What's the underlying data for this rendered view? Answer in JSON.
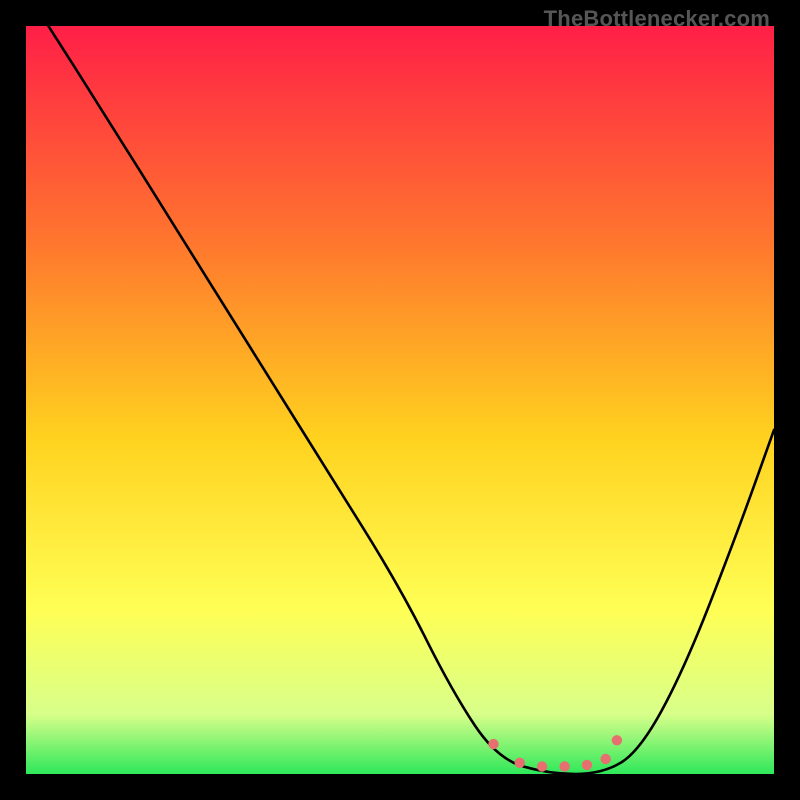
{
  "watermark": "TheBottleneсker.com",
  "chart_data": {
    "type": "line",
    "title": "",
    "xlabel": "",
    "ylabel": "",
    "xlim": [
      0,
      100
    ],
    "ylim": [
      0,
      100
    ],
    "gradient": {
      "top": "#ff1f47",
      "mid1": "#ff7a2d",
      "mid2": "#ffd21f",
      "mid3": "#ffff55",
      "mid4": "#d8ff8a",
      "bottom": "#2ee85a"
    },
    "series": [
      {
        "name": "curve",
        "color": "#000000",
        "x": [
          3,
          10,
          20,
          30,
          40,
          50,
          57,
          63,
          70,
          77,
          82,
          88,
          95,
          100
        ],
        "y": [
          100,
          89,
          73,
          57,
          41,
          25,
          11,
          2,
          0,
          0,
          3,
          14,
          32,
          46
        ]
      }
    ],
    "markers": {
      "color": "#e76f6f",
      "points": [
        {
          "x": 62.5,
          "y": 4
        },
        {
          "x": 66,
          "y": 1.5
        },
        {
          "x": 69,
          "y": 1
        },
        {
          "x": 72,
          "y": 1
        },
        {
          "x": 75,
          "y": 1.2
        },
        {
          "x": 77.5,
          "y": 2.0
        },
        {
          "x": 79,
          "y": 4.5
        }
      ]
    }
  }
}
